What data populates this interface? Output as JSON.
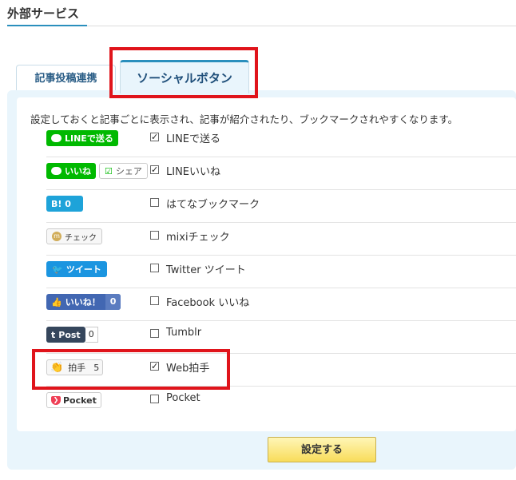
{
  "page": {
    "title": "外部サービス"
  },
  "tabs": [
    {
      "label": "記事投稿連携"
    },
    {
      "label": "ソーシャルボタン"
    }
  ],
  "description": "設定しておくと記事ごとに表示され、記事が紹介されたり、ブックマークされやすくなります。",
  "buttons": {
    "line_send": "LINEで送る",
    "line_like": "いいね",
    "line_share": "シェア",
    "hatena": "B! 0",
    "mixi": "チェック",
    "twitter": "ツイート",
    "facebook": "いいね！",
    "facebook_count": "0",
    "tumblr": "Post",
    "tumblr_count": "0",
    "webclap": "拍手",
    "webclap_count": "5",
    "pocket": "Pocket"
  },
  "rows": [
    {
      "label": "LINEで送る",
      "checked": true
    },
    {
      "label": "LINEいいね",
      "checked": true
    },
    {
      "label": "はてなブックマーク",
      "checked": false
    },
    {
      "label": "mixiチェック",
      "checked": false
    },
    {
      "label": "Twitter ツイート",
      "checked": false
    },
    {
      "label": "Facebook いいね",
      "checked": false
    },
    {
      "label": "Tumblr",
      "checked": false
    },
    {
      "label": "Web拍手",
      "checked": true
    },
    {
      "label": "Pocket",
      "checked": false
    }
  ],
  "submit": {
    "label": "設定する"
  },
  "colors": {
    "accent": "#2a8fbd",
    "highlight": "#e0141b",
    "panel": "#e9f5fc"
  }
}
